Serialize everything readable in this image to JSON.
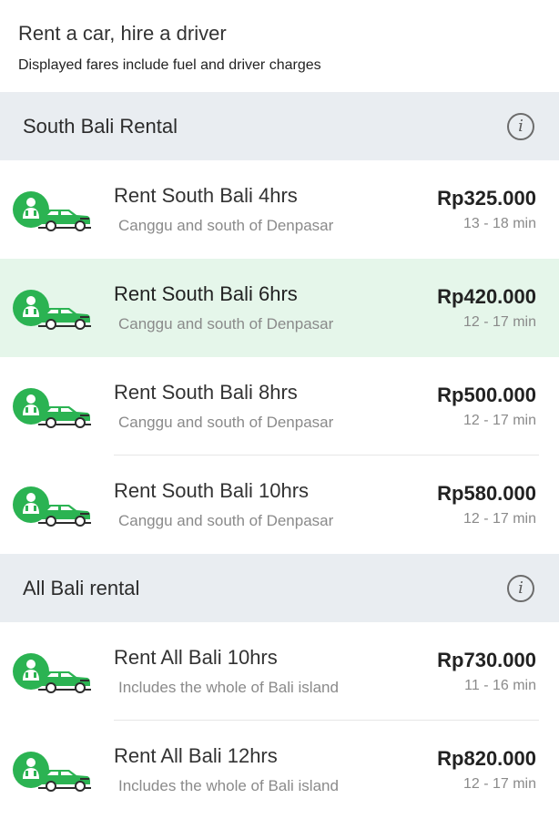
{
  "header": {
    "title": "Rent a car, hire a driver",
    "subtitle": "Displayed fares include fuel and driver charges"
  },
  "sections": [
    {
      "title": "South Bali Rental",
      "info_icon": "info-icon",
      "items": [
        {
          "title": "Rent South Bali 4hrs",
          "subtitle": "Canggu and south of Denpasar",
          "price": "Rp325.000",
          "eta": "13 - 18 min",
          "selected": false
        },
        {
          "title": "Rent South Bali 6hrs",
          "subtitle": "Canggu and south of Denpasar",
          "price": "Rp420.000",
          "eta": "12 - 17 min",
          "selected": true
        },
        {
          "title": "Rent South Bali 8hrs",
          "subtitle": "Canggu and south of Denpasar",
          "price": "Rp500.000",
          "eta": "12 - 17 min",
          "selected": false
        },
        {
          "title": "Rent South Bali 10hrs",
          "subtitle": "Canggu and south of Denpasar",
          "price": "Rp580.000",
          "eta": "12 - 17 min",
          "selected": false
        }
      ]
    },
    {
      "title": "All Bali rental",
      "info_icon": "info-icon",
      "items": [
        {
          "title": "Rent All Bali 10hrs",
          "subtitle": "Includes the whole of Bali island",
          "price": "Rp730.000",
          "eta": "11 - 16 min",
          "selected": false
        },
        {
          "title": "Rent All Bali 12hrs",
          "subtitle": "Includes the whole of Bali island",
          "price": "Rp820.000",
          "eta": "12 - 17 min",
          "selected": false
        }
      ]
    }
  ],
  "colors": {
    "brand_green": "#2bb352",
    "selected_bg": "#e5f6ea",
    "section_bg": "#e9edf1"
  },
  "icons": {
    "row_icon": "driver-car-icon"
  }
}
